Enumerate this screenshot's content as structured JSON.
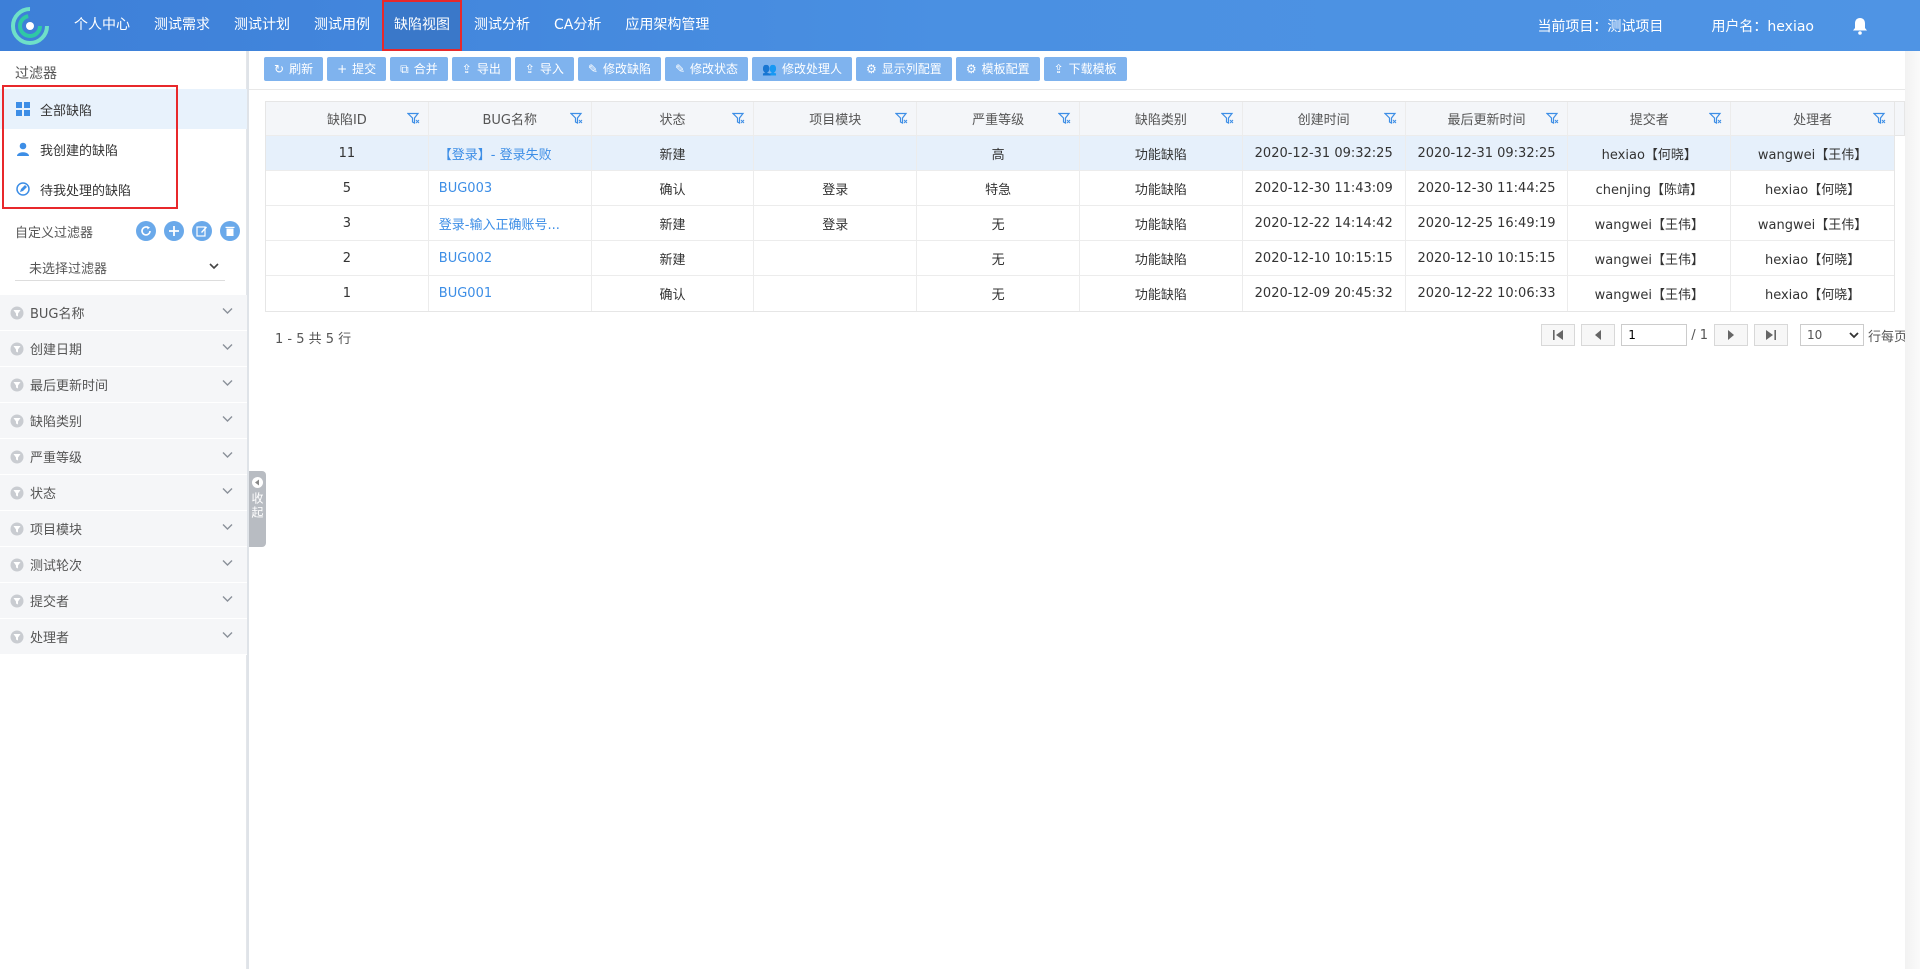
{
  "nav": {
    "items": [
      "个人中心",
      "测试需求",
      "测试计划",
      "测试用例",
      "缺陷视图",
      "测试分析",
      "CA分析",
      "应用架构管理"
    ],
    "active_index": 4,
    "current_project": "当前项目：测试项目",
    "username": "用户名：hexiao"
  },
  "sidebar": {
    "filter_title": "过滤器",
    "quick_filters": [
      "全部缺陷",
      "我创建的缺陷",
      "待我处理的缺陷"
    ],
    "custom_filter_label": "自定义过滤器",
    "filter_select_value": "未选择过滤器",
    "accordion": [
      "BUG名称",
      "创建日期",
      "最后更新时间",
      "缺陷类别",
      "严重等级",
      "状态",
      "项目模块",
      "测试轮次",
      "提交者",
      "处理者"
    ],
    "collapse_label": "收起"
  },
  "toolbar": {
    "buttons": [
      "刷新",
      "提交",
      "合并",
      "导出",
      "导入",
      "修改缺陷",
      "修改状态",
      "修改处理人",
      "显示列配置",
      "模板配置",
      "下载模板"
    ]
  },
  "table": {
    "columns": [
      "缺陷ID",
      "BUG名称",
      "状态",
      "项目模块",
      "严重等级",
      "缺陷类别",
      "创建时间",
      "最后更新时间",
      "提交者",
      "处理者"
    ],
    "rows": [
      [
        "11",
        "【登录】- 登录失败",
        "新建",
        "",
        "高",
        "功能缺陷",
        "2020-12-31 09:32:25",
        "2020-12-31 09:32:25",
        "hexiao【何晓】",
        "wangwei【王伟】"
      ],
      [
        "5",
        "BUG003",
        "确认",
        "登录",
        "特急",
        "功能缺陷",
        "2020-12-30 11:43:09",
        "2020-12-30 11:44:25",
        "chenjing【陈靖】",
        "hexiao【何晓】"
      ],
      [
        "3",
        "登录-输入正确账号...",
        "新建",
        "登录",
        "无",
        "功能缺陷",
        "2020-12-22 14:14:42",
        "2020-12-25 16:49:19",
        "wangwei【王伟】",
        "wangwei【王伟】"
      ],
      [
        "2",
        "BUG002",
        "新建",
        "",
        "无",
        "功能缺陷",
        "2020-12-10 10:15:15",
        "2020-12-10 10:15:15",
        "wangwei【王伟】",
        "hexiao【何晓】"
      ],
      [
        "1",
        "BUG001",
        "确认",
        "",
        "无",
        "功能缺陷",
        "2020-12-09 20:45:32",
        "2020-12-22 10:06:33",
        "wangwei【王伟】",
        "hexiao【何晓】"
      ]
    ],
    "selected_row": 0
  },
  "footer": {
    "summary": "1 - 5 共 5 行",
    "page_value": "1",
    "page_total": "/ 1",
    "page_size": "10",
    "per_page_label": "行每页"
  },
  "colors": {
    "accent": "#4a90e2",
    "button": "#7fb3ee",
    "link": "#3d8ee6",
    "highlight_border": "#e8282b"
  }
}
